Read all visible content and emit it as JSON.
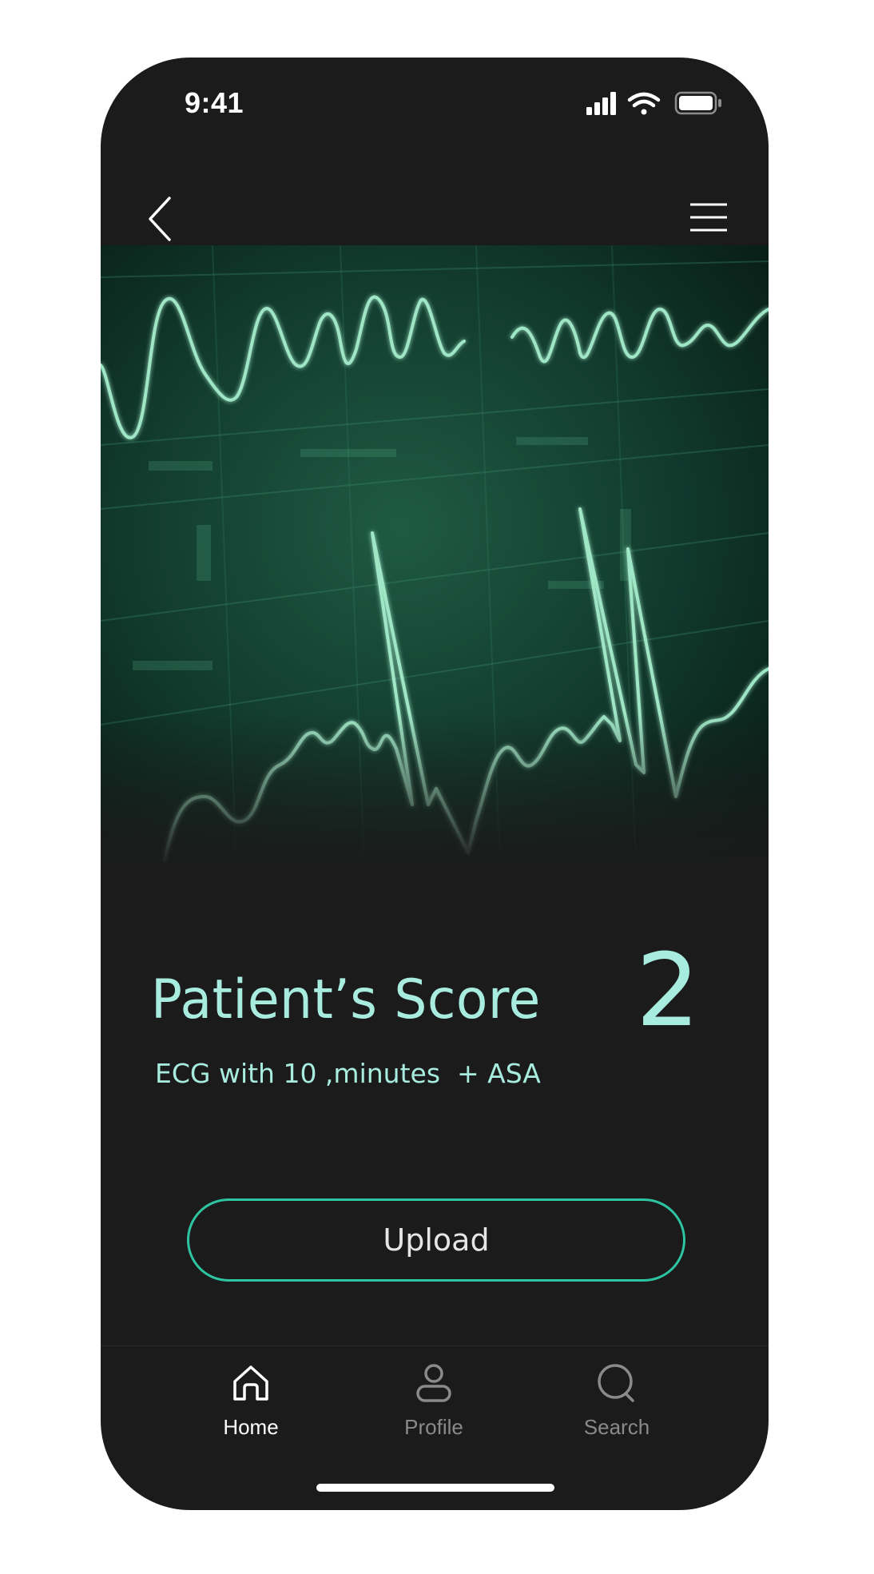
{
  "status_bar": {
    "time": "9:41",
    "icons": [
      "cellular-signal-icon",
      "wifi-icon",
      "battery-icon"
    ]
  },
  "nav": {
    "back_icon": "chevron-left-icon",
    "menu_icon": "hamburger-menu-icon"
  },
  "hero": {
    "image": "ecg-monitor-waveform-image"
  },
  "score": {
    "title": "Patient’s Score",
    "value": "2",
    "subtitle": "ECG with 10 ,minutes  + ASA"
  },
  "upload_button": {
    "label": "Upload"
  },
  "tab_bar": {
    "items": [
      {
        "label": "Home",
        "icon": "home-icon",
        "active": true
      },
      {
        "label": "Profile",
        "icon": "person-icon",
        "active": false
      },
      {
        "label": "Search",
        "icon": "search-icon",
        "active": false
      }
    ]
  },
  "colors": {
    "background": "#1b1b1b",
    "accent_text": "#a7ecdf",
    "button_border": "#2ec4a1",
    "inactive_tab": "#8a8a8a"
  }
}
